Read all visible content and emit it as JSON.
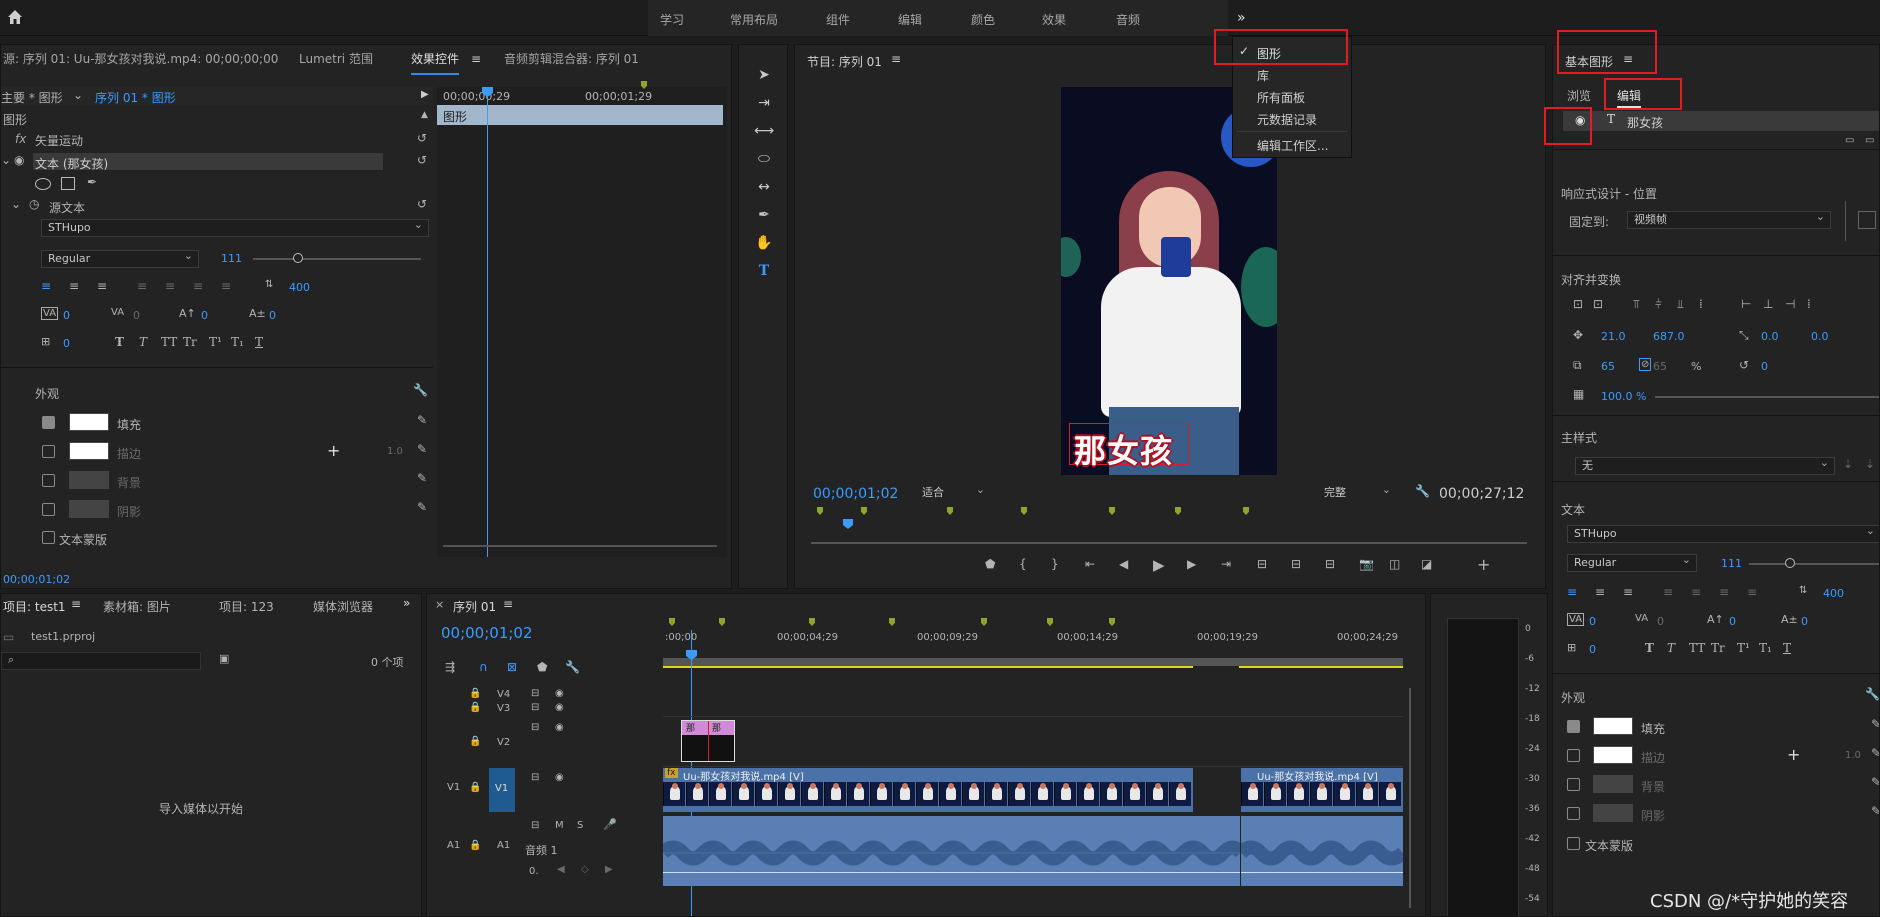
{
  "header": {
    "workspaces": [
      "学习",
      "常用布局",
      "组件",
      "编辑",
      "颜色",
      "效果",
      "音频"
    ],
    "more": "»"
  },
  "workspace_menu": {
    "items": [
      {
        "label": "图形",
        "checked": true
      },
      {
        "label": "库",
        "checked": false
      },
      {
        "label": "所有面板",
        "checked": false
      },
      {
        "label": "元数据记录",
        "checked": false
      },
      {
        "label": "编辑工作区...",
        "checked": false
      }
    ]
  },
  "source_panel": {
    "tabs": [
      "源: 序列 01: Uu-那女孩对我说.mp4: 00;00;00;00",
      "Lumetri 范围",
      "效果控件",
      "音频剪辑混合器: 序列 01"
    ],
    "breadcrumb_master": "主要 * 图形",
    "breadcrumb_seq": "序列 01 * 图形",
    "ruler": [
      "00;00;00;29",
      "00;00;01;29"
    ],
    "clip_label": "图形",
    "section_graphic": "图形",
    "vector_motion": "矢量运动",
    "text_layer": "文本 (那女孩)",
    "source_text": "源文本",
    "font": "STHupo",
    "style": "Regular",
    "size": "111",
    "leading": "400",
    "kerning": "0",
    "tracking": "0",
    "baseline": "0",
    "tsume": "0",
    "indent": "0",
    "tstyles": [
      "T",
      "T",
      "TT",
      "Tr",
      "T¹",
      "T₁",
      "T"
    ],
    "appearance": "外观",
    "fill": "填充",
    "stroke": "描边",
    "stroke_width": "1.0",
    "background": "背景",
    "shadow": "阴影",
    "text_mask": "文本蒙版",
    "timecode": "00;00;01;02"
  },
  "program": {
    "title": "节目: 序列 01",
    "timecode": "00;00;01;02",
    "fit": "适合",
    "quality": "完整",
    "duration": "00;00;27;12",
    "caption": "那女孩"
  },
  "essential_graphics": {
    "title": "基本图形",
    "tabs": [
      "浏览",
      "编辑"
    ],
    "layer": "那女孩",
    "responsive": "响应式设计 - 位置",
    "pin_label": "固定到:",
    "pin_value": "视频帧",
    "align": "对齐并变换",
    "pos_x": "21.0",
    "pos_y": "687.0",
    "anchor_x": "0.0",
    "anchor_y": "0.0",
    "scale": "65",
    "scale2": "65",
    "pct": "%",
    "rotation": "0",
    "opacity": "100.0 %",
    "master_style": "主样式",
    "master_value": "无",
    "text": "文本",
    "font": "STHupo",
    "style": "Regular",
    "size": "111",
    "leading": "400",
    "kerning": "0",
    "tracking": "0",
    "baseline": "0",
    "tsume": "0",
    "indent": "0",
    "appearance": "外观",
    "fill": "填充",
    "stroke": "描边",
    "stroke_width": "1.0",
    "background": "背景",
    "shadow": "阴影",
    "text_mask": "文本蒙版"
  },
  "project": {
    "tabs": [
      "项目: test1",
      "素材箱: 图片",
      "项目: 123",
      "媒体浏览器"
    ],
    "file": "test1.prproj",
    "count": "0 个项",
    "empty": "导入媒体以开始"
  },
  "timeline": {
    "title": "序列 01",
    "timecode": "00;00;01;02",
    "ruler": [
      ":00;00",
      "00;00;04;29",
      "00;00;09;29",
      "00;00;14;29",
      "00;00;19;29",
      "00;00;24;29"
    ],
    "tracks": [
      "V4",
      "V3",
      "V2",
      "V1",
      "A1"
    ],
    "src_v1": "V1",
    "src_a1": "A1",
    "audio_name": "音频 1",
    "clip1": "Uu-那女孩对我说.mp4 [V]",
    "clip2": "Uu-那女孩对我说.mp4 [V]",
    "gfx_clip": "那",
    "gfx_clip2": "那",
    "audio_vol": "0.",
    "meter": [
      "0",
      "-6",
      "-12",
      "-18",
      "-24",
      "-30",
      "-36",
      "-42",
      "-48",
      "-54"
    ]
  },
  "watermark": "CSDN @/*守护她的笑容"
}
